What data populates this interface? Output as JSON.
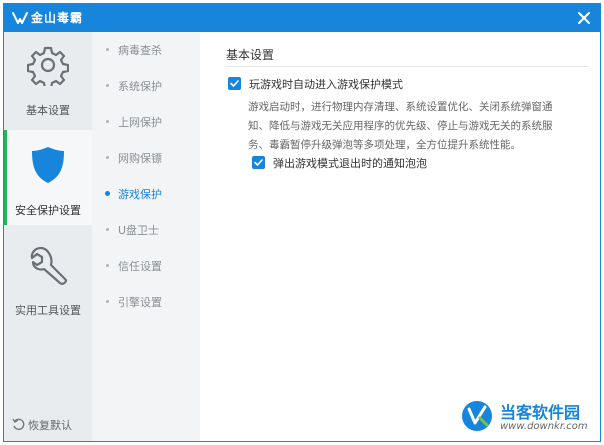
{
  "window": {
    "title": "金山毒霸"
  },
  "colors": {
    "titlebar": "#1685db",
    "accent": "#1685db",
    "active_bar": "#1fb655",
    "left_bg": "#e9ecef",
    "sub_bg": "#f3f4f6"
  },
  "leftnav": {
    "items": [
      {
        "label": "基本设置",
        "icon": "gear-icon",
        "active": false
      },
      {
        "label": "安全保护设置",
        "icon": "shield-icon",
        "active": true
      },
      {
        "label": "实用工具设置",
        "icon": "wrench-icon",
        "active": false
      }
    ],
    "restore_label": "恢复默认"
  },
  "subnav": {
    "items": [
      {
        "label": "病毒查杀",
        "active": false
      },
      {
        "label": "系统保护",
        "active": false
      },
      {
        "label": "上网保护",
        "active": false
      },
      {
        "label": "网购保镖",
        "active": false
      },
      {
        "label": "游戏保护",
        "active": true
      },
      {
        "label": "U盘卫士",
        "active": false
      },
      {
        "label": "信任设置",
        "active": false
      },
      {
        "label": "引擎设置",
        "active": false
      }
    ]
  },
  "content": {
    "section_title": "基本设置",
    "option1": {
      "label": "玩游戏时自动进入游戏保护模式",
      "checked": true
    },
    "description": "游戏启动时，进行物理内存清理、系统设置优化、关闭系统弹窗通知、降低与游戏无关应用程序的优先级、停止与游戏无关的系统服务、毒霸暂停升级弹泡等多项处理，全方位提升系统性能。",
    "option2": {
      "label": "弹出游戏模式退出时的通知泡泡",
      "checked": true
    }
  },
  "watermark": {
    "title": "当客软件园",
    "url": "www.downkr.com"
  }
}
